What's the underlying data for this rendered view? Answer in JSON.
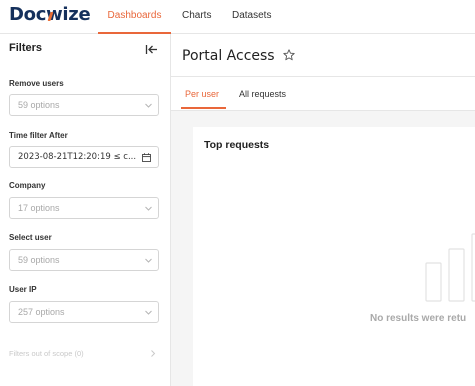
{
  "brand": {
    "logo_text_1": "Doc",
    "logo_text_w": "w",
    "logo_text_2": "ize"
  },
  "nav": {
    "tabs": [
      {
        "label": "Dashboards",
        "active": true
      },
      {
        "label": "Charts",
        "active": false
      },
      {
        "label": "Datasets",
        "active": false
      }
    ]
  },
  "sidebar": {
    "title": "Filters",
    "filters": [
      {
        "label": "Remove users",
        "value": "59 options"
      },
      {
        "label": "Time filter After",
        "value": "2023-08-21T12:20:19 ≤ c..."
      },
      {
        "label": "Company",
        "value": "17 options"
      },
      {
        "label": "Select user",
        "value": "59 options"
      },
      {
        "label": "User IP",
        "value": "257 options"
      }
    ],
    "out_of_scope": "Filters out of scope (0)"
  },
  "main": {
    "title": "Portal Access",
    "tabs": [
      {
        "label": "Per user",
        "active": true
      },
      {
        "label": "All requests",
        "active": false
      }
    ],
    "card": {
      "title": "Top requests",
      "empty_text": "No results were retu"
    }
  },
  "colors": {
    "accent": "#e9673a",
    "brand_navy": "#15305c",
    "border": "#e6e6e6",
    "muted": "#a9a9a9"
  },
  "icons": [
    "collapse-left-icon",
    "chevron-down-icon",
    "calendar-icon",
    "chevron-right-icon",
    "star-icon",
    "empty-chart-icon"
  ]
}
